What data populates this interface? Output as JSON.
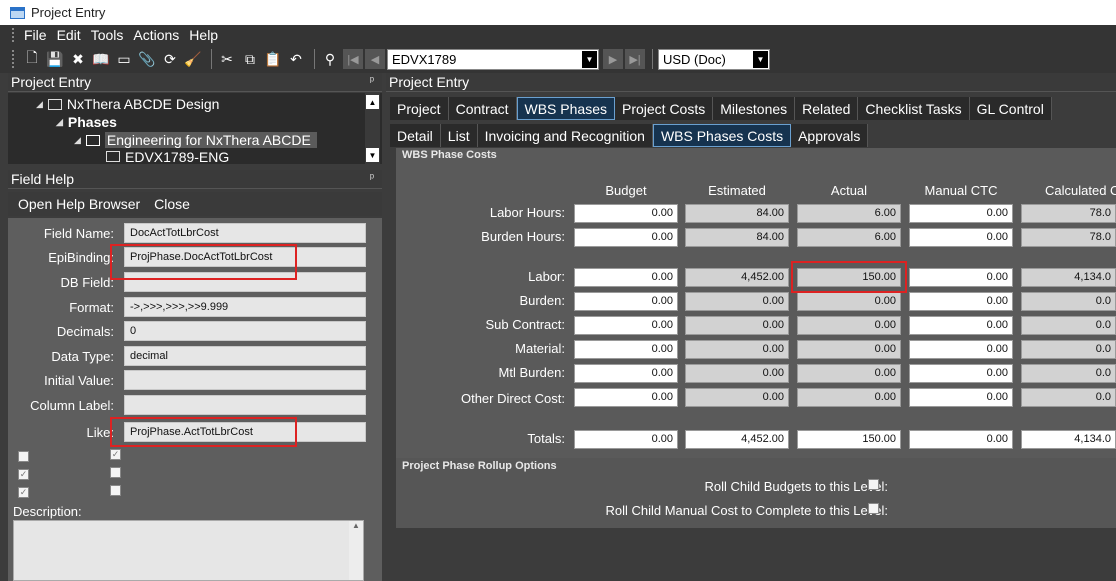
{
  "window": {
    "title": "Project Entry"
  },
  "menu": [
    "File",
    "Edit",
    "Tools",
    "Actions",
    "Help"
  ],
  "toolbar": {
    "record_value": "EDVX1789",
    "currency_value": "USD (Doc)"
  },
  "left_pane": {
    "title": "Project Entry",
    "tree": {
      "root": "NxThera ABCDE Design",
      "phases": "Phases",
      "selected": "Engineering for NxThera ABCDE",
      "child": "EDVX1789-ENG"
    }
  },
  "field_help": {
    "title": "Field Help",
    "actions": [
      "Open Help Browser",
      "Close"
    ],
    "rows": [
      {
        "label": "Field Name:",
        "value": "DocActTotLbrCost"
      },
      {
        "label": "EpiBinding:",
        "value": "ProjPhase.DocActTotLbrCost"
      },
      {
        "label": "DB Field:",
        "value": ""
      },
      {
        "label": "Format:",
        "value": "->,>>>,>>>,>>9.999"
      },
      {
        "label": "Decimals:",
        "value": "0"
      },
      {
        "label": "Data Type:",
        "value": "decimal"
      },
      {
        "label": "Initial Value:",
        "value": ""
      },
      {
        "label": "Column Label:",
        "value": ""
      },
      {
        "label": "Like:",
        "value": "ProjPhase.ActTotLbrCost"
      }
    ],
    "description_label": "Description:"
  },
  "right_pane": {
    "title": "Project Entry",
    "tabs": [
      "Project",
      "Contract",
      "WBS Phases",
      "Project Costs",
      "Milestones",
      "Related",
      "Checklist Tasks",
      "GL Control"
    ],
    "active_tab": "WBS Phases",
    "subtabs": [
      "Detail",
      "List",
      "Invoicing and Recognition",
      "WBS Phases Costs",
      "Approvals"
    ],
    "active_subtab": "WBS Phases Costs",
    "costs": {
      "group_title": "WBS Phase Costs",
      "columns": [
        "Budget",
        "Estimated",
        "Actual",
        "Manual CTC",
        "Calculated C"
      ],
      "rows": [
        {
          "label": "Labor Hours:",
          "values": [
            "0.00",
            "84.00",
            "6.00",
            "0.00",
            "78.0"
          ]
        },
        {
          "label": "Burden Hours:",
          "values": [
            "0.00",
            "84.00",
            "6.00",
            "0.00",
            "78.0"
          ]
        },
        {
          "label": "Labor:",
          "values": [
            "0.00",
            "4,452.00",
            "150.00",
            "0.00",
            "4,134.0"
          ]
        },
        {
          "label": "Burden:",
          "values": [
            "0.00",
            "0.00",
            "0.00",
            "0.00",
            "0.0"
          ]
        },
        {
          "label": "Sub Contract:",
          "values": [
            "0.00",
            "0.00",
            "0.00",
            "0.00",
            "0.0"
          ]
        },
        {
          "label": "Material:",
          "values": [
            "0.00",
            "0.00",
            "0.00",
            "0.00",
            "0.0"
          ]
        },
        {
          "label": "Mtl Burden:",
          "values": [
            "0.00",
            "0.00",
            "0.00",
            "0.00",
            "0.0"
          ]
        },
        {
          "label": "Other Direct Cost:",
          "values": [
            "0.00",
            "0.00",
            "0.00",
            "0.00",
            "0.0"
          ]
        },
        {
          "label": "Totals:",
          "values": [
            "0.00",
            "4,452.00",
            "150.00",
            "0.00",
            "4,134.0"
          ]
        }
      ]
    },
    "rollup": {
      "group_title": "Project Phase Rollup Options",
      "options": [
        "Roll Child Budgets to this Level:",
        "Roll Child Manual Cost to Complete to this Level:"
      ]
    }
  }
}
